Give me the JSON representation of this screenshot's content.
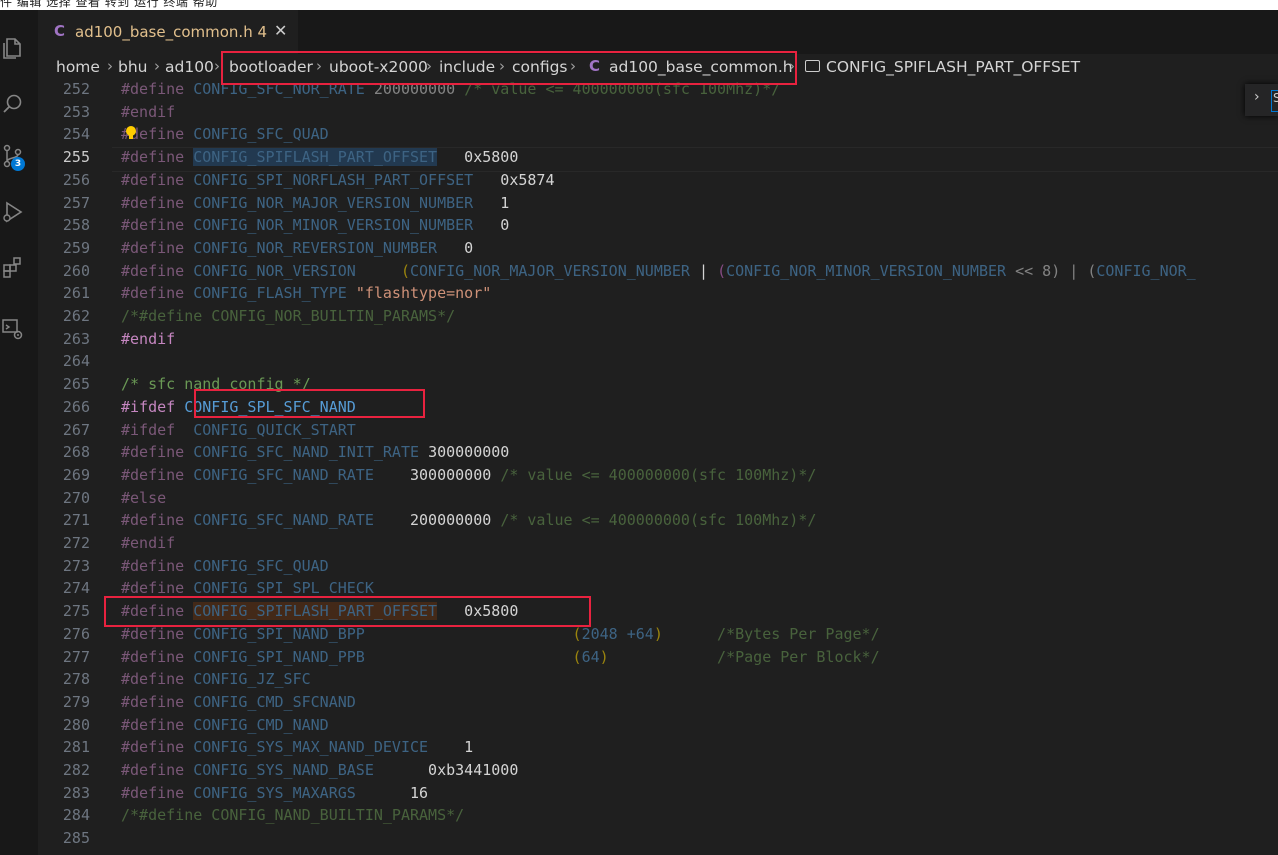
{
  "menubar": {
    "text": "件 编辑 选择 查看 转到 运行 终端 帮助"
  },
  "activity": {
    "icons": [
      "files-icon",
      "search-icon",
      "source-control-icon",
      "run-debug-icon",
      "extensions-icon",
      "remote-explorer-icon"
    ],
    "scm_badge": "3"
  },
  "tab": {
    "lang_glyph": "C",
    "title": "ad100_base_common.h 4",
    "close": "✕"
  },
  "breadcrumb": {
    "parts": [
      "home",
      "bhu",
      "ad100",
      "bootloader",
      "uboot-x2000",
      "include",
      "configs"
    ],
    "file_glyph": "C",
    "file": "ad100_base_common.h",
    "symbol": "CONFIG_SPIFLASH_PART_OFFSET"
  },
  "find_widget": {
    "chevron": "›",
    "partial": "S"
  },
  "lines": [
    {
      "n": "252",
      "t": [
        [
          "#define ",
          "kw dim"
        ],
        [
          "CONFIG_SFC_NOR_RATE ",
          "mac dim"
        ],
        [
          "200000000 ",
          "num dim"
        ],
        [
          "/* value <= 400000000(sfc 100Mhz)*/",
          "cm dim"
        ]
      ]
    },
    {
      "n": "253",
      "t": [
        [
          "#endif",
          "kw dim"
        ]
      ]
    },
    {
      "n": "254",
      "t": [
        [
          "#define ",
          "kw dim"
        ],
        [
          "CONFIG_SFC_QUAD",
          "mac dim"
        ]
      ]
    },
    {
      "n": "255",
      "t": [
        [
          "#define ",
          "kw dim"
        ],
        [
          "CONFIG_SPIFLASH_PART_OFFSET",
          "mac dim hl"
        ],
        [
          "   0x5800",
          "num"
        ]
      ]
    },
    {
      "n": "256",
      "t": [
        [
          "#define ",
          "kw dim"
        ],
        [
          "CONFIG_SPI_NORFLASH_PART_OFFSET",
          "mac dim"
        ],
        [
          "   0x5874",
          "num"
        ]
      ]
    },
    {
      "n": "257",
      "t": [
        [
          "#define ",
          "kw dim"
        ],
        [
          "CONFIG_NOR_MAJOR_VERSION_NUMBER",
          "mac dim"
        ],
        [
          "   1",
          "num"
        ]
      ]
    },
    {
      "n": "258",
      "t": [
        [
          "#define ",
          "kw dim"
        ],
        [
          "CONFIG_NOR_MINOR_VERSION_NUMBER",
          "mac dim"
        ],
        [
          "   0",
          "num"
        ]
      ]
    },
    {
      "n": "259",
      "t": [
        [
          "#define ",
          "kw dim"
        ],
        [
          "CONFIG_NOR_REVERSION_NUMBER",
          "mac dim"
        ],
        [
          "   0",
          "num"
        ]
      ]
    },
    {
      "n": "260",
      "t": [
        [
          "#define ",
          "kw dim"
        ],
        [
          "CONFIG_NOR_VERSION",
          "mac dim"
        ],
        [
          "     (",
          "par2 dim"
        ],
        [
          "CONFIG_NOR_MAJOR_VERSION_NUMBER",
          "mac dim"
        ],
        [
          " | ",
          "pl"
        ],
        [
          "(",
          "par dim"
        ],
        [
          "CONFIG_NOR_MINOR_VERSION_NUMBER",
          "mac dim"
        ],
        [
          " << 8) | (",
          "pl dim"
        ],
        [
          "CONFIG_NOR_",
          "mac dim"
        ]
      ]
    },
    {
      "n": "261",
      "t": [
        [
          "#define ",
          "kw dim"
        ],
        [
          "CONFIG_FLASH_TYPE ",
          "mac dim"
        ],
        [
          "\"flashtype=nor\"",
          "str"
        ]
      ]
    },
    {
      "n": "262",
      "t": [
        [
          "/*#define CONFIG_NOR_BUILTIN_PARAMS*/",
          "cm dim"
        ]
      ]
    },
    {
      "n": "263",
      "t": [
        [
          "#endif",
          "kw"
        ]
      ]
    },
    {
      "n": "264",
      "t": []
    },
    {
      "n": "265",
      "t": [
        [
          "/* sfc nand config */",
          "cm"
        ]
      ]
    },
    {
      "n": "266",
      "t": [
        [
          "#ifdef ",
          "kw"
        ],
        [
          "CONFIG_SPL_SFC_NAND",
          "mac"
        ]
      ]
    },
    {
      "n": "267",
      "t": [
        [
          "#ifdef  ",
          "kw dim"
        ],
        [
          "CONFIG_QUICK_START",
          "mac dim"
        ]
      ]
    },
    {
      "n": "268",
      "t": [
        [
          "#define ",
          "kw dim"
        ],
        [
          "CONFIG_SFC_NAND_INIT_RATE ",
          "mac dim"
        ],
        [
          "300000000",
          "num"
        ]
      ]
    },
    {
      "n": "269",
      "t": [
        [
          "#define ",
          "kw dim"
        ],
        [
          "CONFIG_SFC_NAND_RATE",
          "mac dim"
        ],
        [
          "    300000000 ",
          "num"
        ],
        [
          "/* value <= 400000000(sfc 100Mhz)*/",
          "cm dim"
        ]
      ]
    },
    {
      "n": "270",
      "t": [
        [
          "#else",
          "kw dim"
        ]
      ]
    },
    {
      "n": "271",
      "t": [
        [
          "#define ",
          "kw dim"
        ],
        [
          "CONFIG_SFC_NAND_RATE",
          "mac dim"
        ],
        [
          "    200000000 ",
          "num"
        ],
        [
          "/* value <= 400000000(sfc 100Mhz)*/",
          "cm dim"
        ]
      ]
    },
    {
      "n": "272",
      "t": [
        [
          "#endif",
          "kw dim"
        ]
      ]
    },
    {
      "n": "273",
      "t": [
        [
          "#define ",
          "kw dim"
        ],
        [
          "CONFIG_SFC_QUAD",
          "mac dim"
        ]
      ]
    },
    {
      "n": "274",
      "t": [
        [
          "#define ",
          "kw dim"
        ],
        [
          "CONFIG_SPI_SPL_CHECK",
          "mac dim"
        ]
      ]
    },
    {
      "n": "275",
      "t": [
        [
          "#define ",
          "kw dim"
        ],
        [
          "CONFIG_SPIFLASH_PART_OFFSET",
          "mac dim hl2"
        ],
        [
          "   0x5800",
          "num"
        ]
      ]
    },
    {
      "n": "276",
      "t": [
        [
          "#define ",
          "kw dim"
        ],
        [
          "CONFIG_SPI_NAND_BPP",
          "mac dim"
        ],
        [
          "                       (",
          "par2 dim"
        ],
        [
          "2048 +64",
          "mac dim"
        ],
        [
          ")",
          "par2 dim"
        ],
        [
          "      /*Bytes Per Page*/",
          "cm dim"
        ]
      ]
    },
    {
      "n": "277",
      "t": [
        [
          "#define ",
          "kw dim"
        ],
        [
          "CONFIG_SPI_NAND_PPB",
          "mac dim"
        ],
        [
          "                       (",
          "par2 dim"
        ],
        [
          "64",
          "mac dim"
        ],
        [
          ")",
          "par2 dim"
        ],
        [
          "            /*Page Per Block*/",
          "cm dim"
        ]
      ]
    },
    {
      "n": "278",
      "t": [
        [
          "#define ",
          "kw dim"
        ],
        [
          "CONFIG_JZ_SFC",
          "mac dim"
        ]
      ]
    },
    {
      "n": "279",
      "t": [
        [
          "#define ",
          "kw dim"
        ],
        [
          "CONFIG_CMD_SFCNAND",
          "mac dim"
        ]
      ]
    },
    {
      "n": "280",
      "t": [
        [
          "#define ",
          "kw dim"
        ],
        [
          "CONFIG_CMD_NAND",
          "mac dim"
        ]
      ]
    },
    {
      "n": "281",
      "t": [
        [
          "#define ",
          "kw dim"
        ],
        [
          "CONFIG_SYS_MAX_NAND_DEVICE",
          "mac dim"
        ],
        [
          "    1",
          "num"
        ]
      ]
    },
    {
      "n": "282",
      "t": [
        [
          "#define ",
          "kw dim"
        ],
        [
          "CONFIG_SYS_NAND_BASE",
          "mac dim"
        ],
        [
          "      0xb3441000",
          "num"
        ]
      ]
    },
    {
      "n": "283",
      "t": [
        [
          "#define ",
          "kw dim"
        ],
        [
          "CONFIG_SYS_MAXARGS",
          "mac dim"
        ],
        [
          "      16",
          "num"
        ]
      ]
    },
    {
      "n": "284",
      "t": [
        [
          "/*#define CONFIG_NAND_BUILTIN_PARAMS*/",
          "cm dim"
        ]
      ]
    },
    {
      "n": "285",
      "t": []
    }
  ],
  "colors": {
    "accent": "#0078d4",
    "annotation": "#e8223f"
  }
}
